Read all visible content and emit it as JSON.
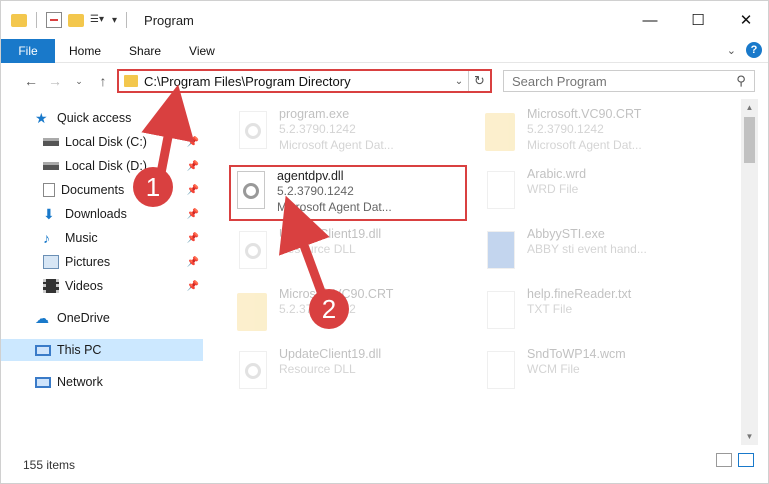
{
  "window": {
    "title": "Program",
    "controls": {
      "minimize": "—",
      "maximize": "☐",
      "close": "✕"
    }
  },
  "ribbon": {
    "tabs": [
      "File",
      "Home",
      "Share",
      "View"
    ]
  },
  "navigation": {
    "address": "C:\\Program Files\\Program Directory",
    "search_placeholder": "Search Program"
  },
  "sidebar": {
    "items": [
      {
        "label": "Quick access",
        "icon": "star-icon"
      },
      {
        "label": "Local Disk (C:)",
        "icon": "drive-icon",
        "pinned": true
      },
      {
        "label": "Local Disk (D:)",
        "icon": "drive-icon",
        "pinned": true
      },
      {
        "label": "Documents",
        "icon": "documents-icon",
        "pinned": true
      },
      {
        "label": "Downloads",
        "icon": "download-icon",
        "pinned": true
      },
      {
        "label": "Music",
        "icon": "music-icon",
        "pinned": true
      },
      {
        "label": "Pictures",
        "icon": "pictures-icon",
        "pinned": true
      },
      {
        "label": "Videos",
        "icon": "videos-icon",
        "pinned": true
      },
      {
        "label": "OneDrive",
        "icon": "cloud-icon"
      },
      {
        "label": "This PC",
        "icon": "computer-icon",
        "selected": true
      },
      {
        "label": "Network",
        "icon": "network-icon"
      }
    ]
  },
  "files": [
    {
      "name": "program.exe",
      "line2": "5.2.3790.1242",
      "line3": "Microsoft Agent Dat...",
      "kind": "exe"
    },
    {
      "name": "Microsoft.VC90.CRT",
      "line2": "5.2.3790.1242",
      "line3": "Microsoft Agent Dat...",
      "kind": "folder"
    },
    {
      "name": "agentdpv.dll",
      "line2": "5.2.3790.1242",
      "line3": "Microsoft Agent Dat...",
      "kind": "dll",
      "highlighted": true
    },
    {
      "name": "Arabic.wrd",
      "line2": "WRD File",
      "line3": "",
      "kind": "file"
    },
    {
      "name": "UpdateClient19.dll",
      "line2": "Resource DLL",
      "line3": "",
      "kind": "dll"
    },
    {
      "name": "AbbyySTI.exe",
      "line2": "ABBY sti event hand...",
      "line3": "",
      "kind": "exe"
    },
    {
      "name": "Microsoft.VC90.CRT",
      "line2": "5.2.3790.1242",
      "line3": "",
      "kind": "folder"
    },
    {
      "name": "help.fineReader.txt",
      "line2": "TXT File",
      "line3": "",
      "kind": "file"
    },
    {
      "name": "UpdateClient19.dll",
      "line2": "Resource DLL",
      "line3": "",
      "kind": "dll"
    },
    {
      "name": "SndToWP14.wcm",
      "line2": "WCM File",
      "line3": "",
      "kind": "file"
    }
  ],
  "annotations": {
    "step1": "1",
    "step2": "2"
  },
  "status": {
    "count": "155 items"
  },
  "colors": {
    "accent": "#1979ca",
    "highlight": "#d94040",
    "selected_nav": "#cce8ff"
  }
}
